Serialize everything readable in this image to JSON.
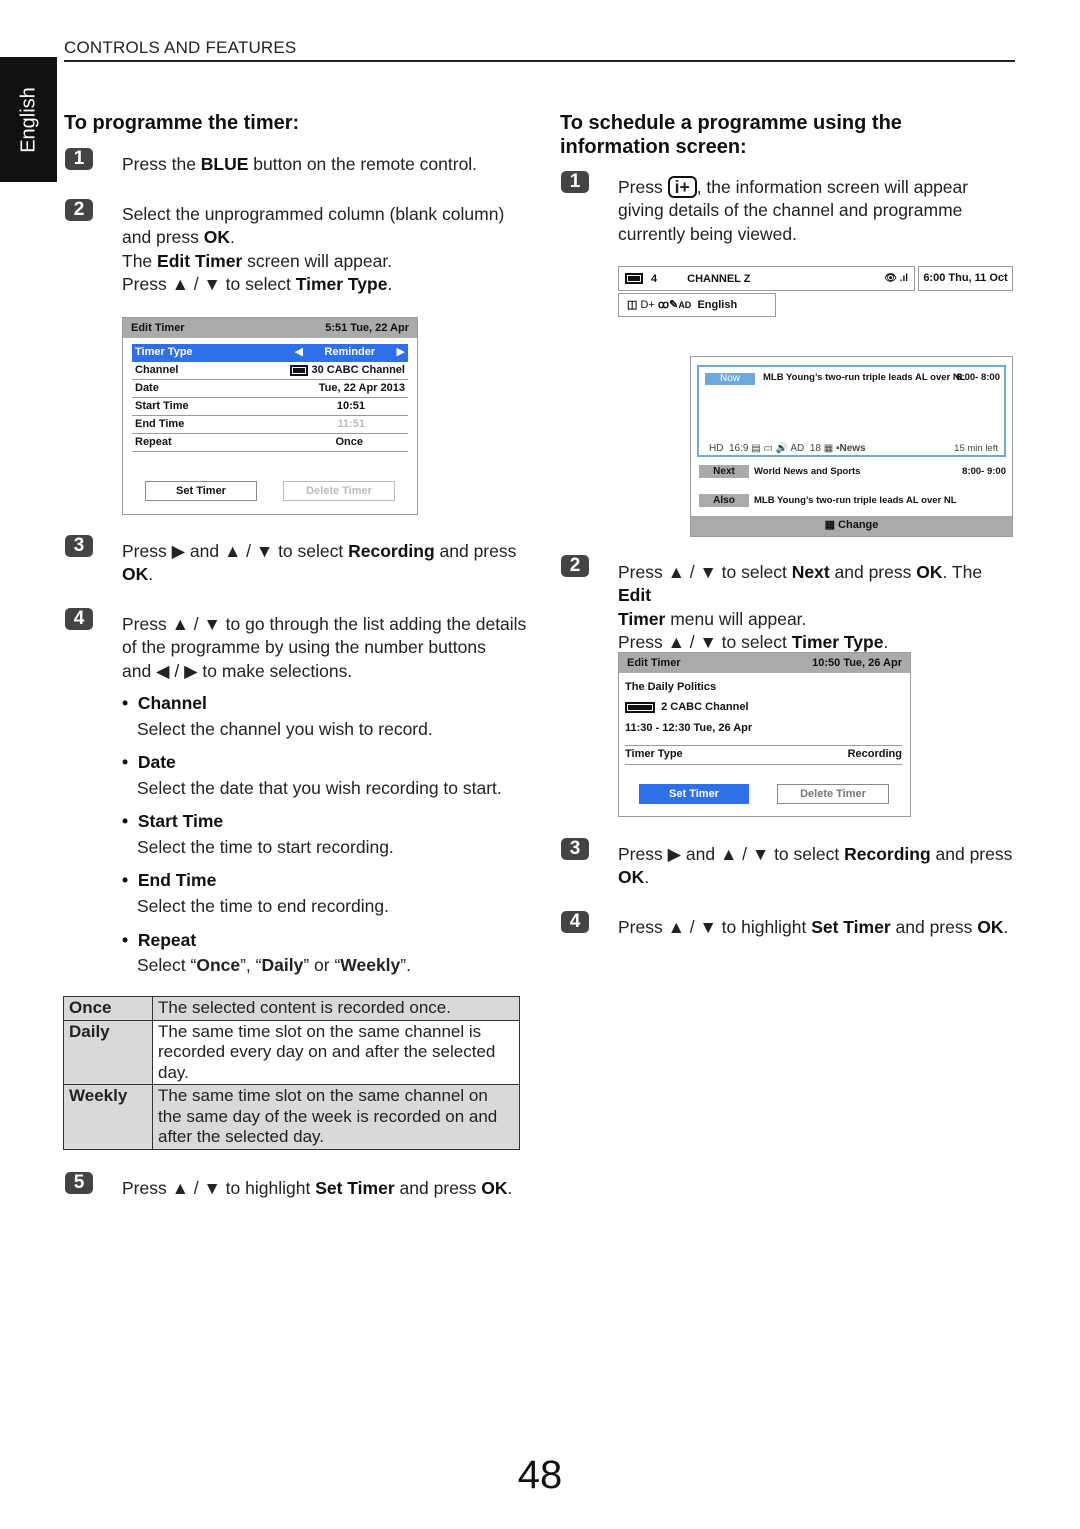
{
  "header": {
    "section": "CONTROLS AND FEATURES",
    "language_tab": "English"
  },
  "left": {
    "title": "To programme the timer:",
    "steps": [
      {
        "n": "1",
        "html_parts": [
          "Press the ",
          "BLUE",
          " button on the remote control."
        ]
      },
      {
        "n": "2",
        "lines": [
          "Select the unprogrammed column (blank column)",
          "and press ",
          "OK",
          ".",
          "The ",
          "Edit Timer",
          " screen will appear.",
          "Press ▲ / ▼ to select ",
          "Timer Type",
          "."
        ]
      },
      {
        "n": "3",
        "a": "Press ▶ and ▲ / ▼ to select ",
        "b": "Recording",
        "c": " and press",
        "d": "OK",
        "e": "."
      },
      {
        "n": "4",
        "l1": "Press ▲ / ▼ to go through the list adding the details",
        "l2": "of the programme by using the number buttons",
        "l3": "and ◀ / ▶ to make selections."
      },
      {
        "n": "5",
        "a": "Press ▲ / ▼ to highlight ",
        "b": "Set Timer",
        "c": " and press ",
        "d": "OK",
        "e": "."
      }
    ],
    "bullets": [
      {
        "title": "Channel",
        "text": "Select the channel you wish to record."
      },
      {
        "title": "Date",
        "text": "Select the date that you wish recording to start."
      },
      {
        "title": "Start Time",
        "text": "Select the time to start recording."
      },
      {
        "title": "End Time",
        "text": "Select the time to end recording."
      },
      {
        "title": "Repeat",
        "text_parts": [
          "Select “",
          "Once",
          "”, “",
          "Daily",
          "” or “",
          "Weekly",
          "”."
        ]
      }
    ],
    "table": [
      {
        "term": "Once",
        "desc": "The selected content is recorded once."
      },
      {
        "term": "Daily",
        "desc": "The same time slot on the same channel is recorded every day on and after the selected day."
      },
      {
        "term": "Weekly",
        "desc": "The same time slot on the same channel on the same day of the week is recorded on and after the selected day."
      }
    ],
    "edit_timer": {
      "title": "Edit Timer",
      "datetime": "5:51 Tue, 22 Apr",
      "rows": [
        {
          "label": "Timer Type",
          "value": "Reminder",
          "selected": true
        },
        {
          "label": "Channel",
          "value": "30 CABC Channel"
        },
        {
          "label": "Date",
          "value": "Tue, 22 Apr 2013"
        },
        {
          "label": "Start Time",
          "value": "10:51"
        },
        {
          "label": "End Time",
          "value": "11:51",
          "disabled": true
        },
        {
          "label": "Repeat",
          "value": "Once"
        }
      ],
      "set_timer": "Set Timer",
      "delete_timer": "Delete Timer"
    }
  },
  "right": {
    "title_l1": "To schedule a programme using the",
    "title_l2": "information screen:",
    "step1": {
      "n": "1",
      "a": "Press ",
      "key": "i+",
      "b": ", the information screen will appear",
      "l2": "giving details of the channel and programme",
      "l3": "currently being viewed."
    },
    "banner": {
      "channel_num": "4",
      "channel_name": "CHANNEL Z",
      "datetime": "6:00 Thu, 11 Oct",
      "audio": "English",
      "dplus": "D+",
      "ad": "AD"
    },
    "info": {
      "now_label": "Now",
      "now_title": "MLB Young’s two-run triple leads AL over NL",
      "now_time": "6:00- 8:00",
      "icons_row": [
        "HD",
        "16:9",
        "AD",
        "18",
        "News"
      ],
      "left": "15 min left",
      "next_label": "Next",
      "next_title": "World News and Sports",
      "next_time": "8:00- 9:00",
      "also_label": "Also",
      "also_title": "MLB Young’s two-run triple leads AL over NL",
      "change": "Change"
    },
    "step2": {
      "n": "2",
      "a": "Press ▲ / ▼ to select ",
      "b": "Next",
      "c": " and press ",
      "d": "OK",
      "e": ". The ",
      "f": "Edit",
      "g": "Timer",
      "h": " menu will appear.",
      "l3a": "Press ▲ / ▼ to select ",
      "l3b": "Timer Type",
      "l3c": "."
    },
    "edit_timer2": {
      "title": "Edit Timer",
      "datetime": "10:50 Tue, 26 Apr",
      "programme": "The Daily Politics",
      "channel": "2  CABC  Channel",
      "time": "11:30 - 12:30 Tue, 26 Apr",
      "timer_type_label": "Timer Type",
      "timer_type_value": "Recording",
      "set_timer": "Set Timer",
      "delete_timer": "Delete Timer"
    },
    "step3": {
      "n": "3",
      "a": "Press ▶ and ▲ / ▼ to select ",
      "b": "Recording",
      "c": " and press",
      "d": "OK",
      "e": "."
    },
    "step4": {
      "n": "4",
      "a": "Press ▲ / ▼ to highlight ",
      "b": "Set Timer",
      "c": " and press ",
      "d": "OK",
      "e": "."
    }
  },
  "page_number": "48",
  "colors": {
    "highlight_blue": "#2f6fe8",
    "header_gray": "#aaaaaa",
    "table_gray": "#d9d9d9"
  }
}
